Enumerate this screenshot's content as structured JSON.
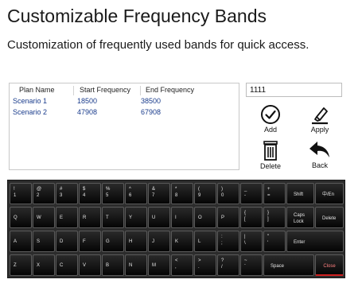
{
  "title": "Customizable Frequency Bands",
  "subtitle": "Customization of frequently used bands for quick access.",
  "table": {
    "headers": [
      "Plan Name",
      "Start Frequency",
      "End Frequency"
    ],
    "rows": [
      {
        "name": "Scenario 1",
        "start": "18500",
        "end": "38500"
      },
      {
        "name": "Scenario 2",
        "start": "47908",
        "end": "67908"
      }
    ]
  },
  "input": {
    "value": "1111"
  },
  "actions": {
    "add": "Add",
    "apply": "Apply",
    "delete": "Delete",
    "back": "Back"
  },
  "keyboard": {
    "row1": [
      {
        "t": "!",
        "b": "1"
      },
      {
        "t": "@",
        "b": "2"
      },
      {
        "t": "#",
        "b": "3"
      },
      {
        "t": "$",
        "b": "4"
      },
      {
        "t": "%",
        "b": "5"
      },
      {
        "t": "^",
        "b": "6"
      },
      {
        "t": "&",
        "b": "7"
      },
      {
        "t": "*",
        "b": "8"
      },
      {
        "t": "(",
        "b": "9"
      },
      {
        "t": ")",
        "b": "0"
      },
      {
        "t": "_",
        "b": "-"
      },
      {
        "t": "+",
        "b": "="
      }
    ],
    "row2": [
      "Q",
      "W",
      "E",
      "R",
      "T",
      "Y",
      "U",
      "I",
      "O",
      "P"
    ],
    "row2_brackets": [
      {
        "t": "{",
        "b": "["
      },
      {
        "t": "}",
        "b": "]"
      }
    ],
    "row3": [
      "A",
      "S",
      "D",
      "F",
      "G",
      "H",
      "J",
      "K",
      "L"
    ],
    "row3_punct": [
      {
        "t": ":",
        "b": ";"
      },
      {
        "t": "|",
        "b": "\\"
      },
      {
        "t": "\"",
        "b": "'"
      }
    ],
    "row4": [
      "Z",
      "X",
      "C",
      "V",
      "B",
      "N",
      "M"
    ],
    "row4_punct": [
      {
        "t": "<",
        "b": ","
      },
      {
        "t": ">",
        "b": "."
      },
      {
        "t": "?",
        "b": "/"
      },
      {
        "t": "~",
        "b": "`"
      }
    ],
    "shift": "Shift",
    "lang": "中/En",
    "caps_top": "Caps",
    "caps_bottom": "Lock",
    "delete": "Delete",
    "enter": "Enter",
    "space": "Space",
    "close": "Close"
  }
}
